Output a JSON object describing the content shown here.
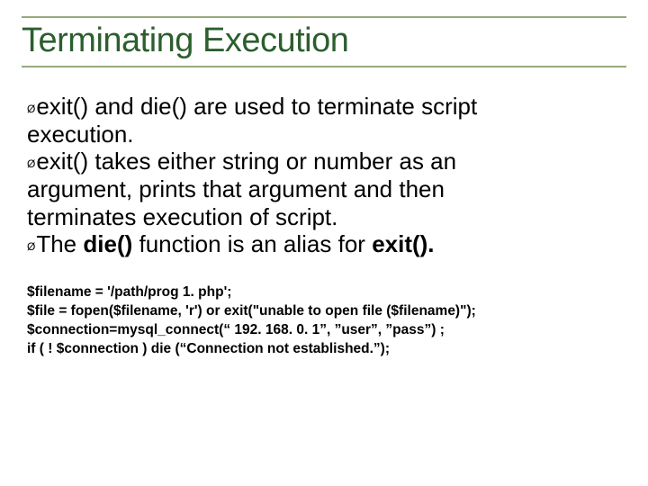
{
  "title": "Terminating Execution",
  "bullets": {
    "b1a": "exit() and die() are used to terminate script",
    "b1b": "execution.",
    "b2a": "exit() takes either string or number as an",
    "b2b": "argument, prints that argument and then",
    "b2c": "terminates execution of script.",
    "b3_pre": "The ",
    "b3_die": "die()",
    "b3_mid": " function is an alias for ",
    "b3_exit": "exit()."
  },
  "code": {
    "l1": "$filename = '/path/prog 1. php';",
    "l2": "$file = fopen($filename, 'r')  or exit(\"unable to open file ($filename)\");",
    "l3": "$connection=mysql_connect(“ 192. 168. 0. 1”, ”user”, ”pass”) ;",
    "l4": "if ( ! $connection ) die (“Connection not established.”);"
  }
}
